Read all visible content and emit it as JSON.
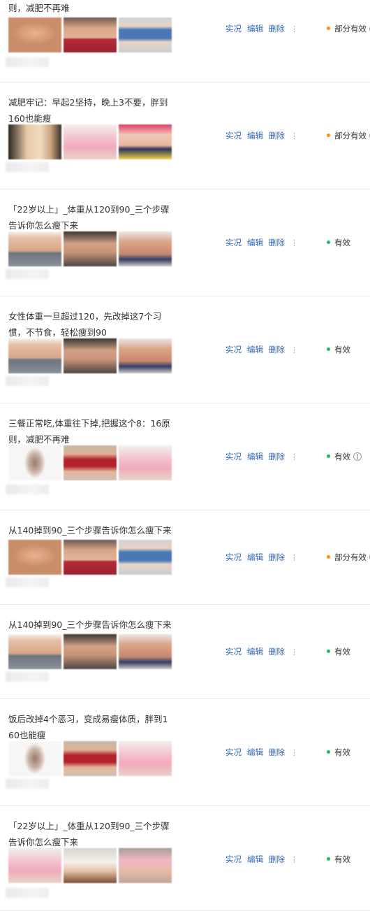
{
  "actions": {
    "live": "实况",
    "edit": "编辑",
    "delete": "删除",
    "more": "⋮"
  },
  "colors": {
    "link": "#2d64b3",
    "valid": "#1bbf66",
    "partial": "#ff9100",
    "divider": "#ececec"
  },
  "rows": [
    {
      "title": "则，减肥不再难",
      "status": "部分有效",
      "status_type": "partial",
      "info": "i",
      "thumbs": [
        "tan midriff with jeans",
        "belly in red shorts",
        "woman in blue top"
      ]
    },
    {
      "title": "减肥牢记：早起2坚持，晚上3不要，胖到160也能瘦",
      "status": "部分有效",
      "status_type": "partial",
      "info": "i",
      "thumbs": [
        "woman with weight badge",
        "woman in pink top",
        "woman in navy shorts"
      ]
    },
    {
      "title": "「22岁以上」_体重从120到90_三个步骤告诉你怎么瘦下来",
      "status": "有效",
      "status_type": "valid",
      "thumbs": [
        "waist in grey jeans",
        "belly in dark room",
        "toned abdomen"
      ]
    },
    {
      "title": "女性体重一旦超过120，先改掉这7个习惯，不节食，轻松瘦到90",
      "status": "有效",
      "status_type": "valid",
      "thumbs": [
        "waist in grey jeans",
        "belly in dark room",
        "toned abdomen"
      ]
    },
    {
      "title": "三餐正常吃,体重往下掉,把握这个8：16原则，减肥不再难",
      "status": "有效",
      "status_type": "valid",
      "info": "‖",
      "thumbs": [
        "woman standing full body",
        "woman in red crop top",
        "woman in pink top"
      ]
    },
    {
      "title": "从140掉到90_三个步骤告诉你怎么瘦下来",
      "status": "部分有效",
      "status_type": "partial",
      "info": "i",
      "thumbs": [
        "tan midriff with jeans",
        "belly in red shorts",
        "woman in blue top"
      ]
    },
    {
      "title": "从140掉到90_三个步骤告诉你怎么瘦下来",
      "status": "有效",
      "status_type": "valid",
      "thumbs": [
        "waist in grey jeans",
        "belly in dark room",
        "toned abdomen"
      ]
    },
    {
      "title": "饭后改掉4个恶习，变成易瘦体质，胖到160也能瘦",
      "status": "有效",
      "status_type": "valid",
      "thumbs": [
        "woman standing full body",
        "woman in red crop top",
        "woman in pink top"
      ]
    },
    {
      "title": "「22岁以上」_体重从120到90_三个步骤告诉你怎么瘦下来",
      "status": "有效",
      "status_type": "valid",
      "thumbs": [
        "woman in pink top",
        "woman in white shirt",
        "woman in pink crop top"
      ]
    }
  ]
}
